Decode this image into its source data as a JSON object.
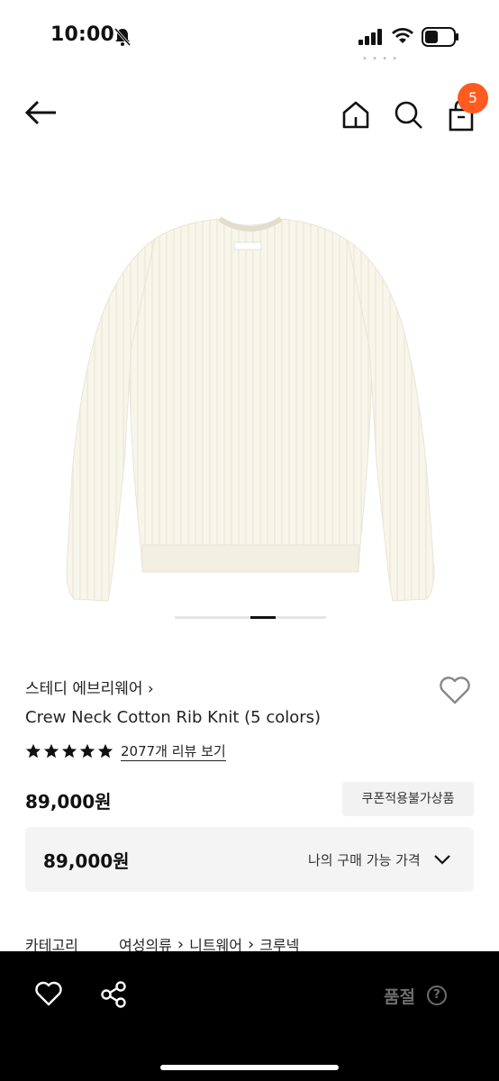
{
  "status_bar": {
    "time": "10:00",
    "icons": [
      "bell-slash-icon",
      "signal-icon",
      "wifi-icon",
      "battery-icon"
    ]
  },
  "nav": {
    "cart_count": "5",
    "icons": [
      "back-arrow-icon",
      "home-icon",
      "search-icon",
      "shopping-bag-icon"
    ],
    "badge_color": "#ff5a1f"
  },
  "carousel": {
    "active_index": 0
  },
  "product": {
    "brand": "스테디 에브리웨어 ›",
    "name": "Crew Neck Cotton Rib Knit (5 colors)",
    "rating": 5,
    "review_link": "2077개 리뷰 보기",
    "price": "89,000원",
    "coupon_badge": "쿠폰적용불가상품"
  },
  "price_box": {
    "price": "89,000원",
    "label": "나의 구매 가능 가격"
  },
  "category": {
    "label": "카테고리",
    "path": [
      "여성의류",
      "니트웨어",
      "크루넥"
    ]
  },
  "bottom_bar": {
    "status": "품절",
    "help": "?",
    "icons": [
      "heart-icon",
      "share-icon",
      "help-icon"
    ],
    "background": "#000000"
  }
}
